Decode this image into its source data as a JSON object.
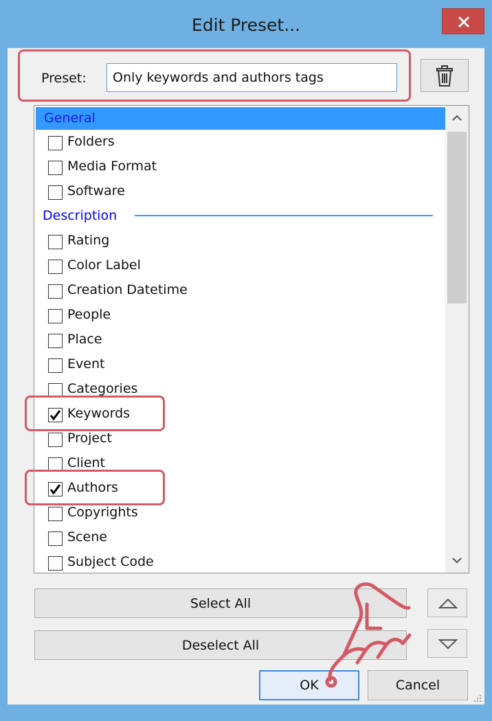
{
  "window": {
    "title": "Edit Preset..."
  },
  "preset": {
    "label": "Preset:",
    "value": "Only keywords and authors tags"
  },
  "list": {
    "headers": {
      "general": "General",
      "description": "Description"
    },
    "general_items": [
      {
        "label": "Folders",
        "checked": false
      },
      {
        "label": "Media Format",
        "checked": false
      },
      {
        "label": "Software",
        "checked": false
      }
    ],
    "description_items": [
      {
        "label": "Rating",
        "checked": false
      },
      {
        "label": "Color Label",
        "checked": false
      },
      {
        "label": "Creation Datetime",
        "checked": false
      },
      {
        "label": "People",
        "checked": false
      },
      {
        "label": "Place",
        "checked": false
      },
      {
        "label": "Event",
        "checked": false
      },
      {
        "label": "Categories",
        "checked": false
      },
      {
        "label": "Keywords",
        "checked": true
      },
      {
        "label": "Project",
        "checked": false
      },
      {
        "label": "Client",
        "checked": false
      },
      {
        "label": "Authors",
        "checked": true
      },
      {
        "label": "Copyrights",
        "checked": false
      },
      {
        "label": "Scene",
        "checked": false
      },
      {
        "label": "Subject Code",
        "checked": false
      }
    ]
  },
  "buttons": {
    "select_all": "Select All",
    "deselect_all": "Deselect All",
    "ok": "OK",
    "cancel": "Cancel"
  },
  "icons": {
    "close": "close-icon",
    "trash": "trash-icon",
    "move_up": "triangle-up-icon",
    "move_down": "triangle-down-icon",
    "scroll_up": "chevron-up-icon",
    "scroll_down": "chevron-down-icon",
    "pointer_hand": "pointing-hand-icon"
  },
  "colors": {
    "title_bar": "#6fb0e2",
    "close": "#c94a46",
    "highlight_box": "#d25a66",
    "selection": "#3399ff",
    "header_text": "#0000ff"
  }
}
